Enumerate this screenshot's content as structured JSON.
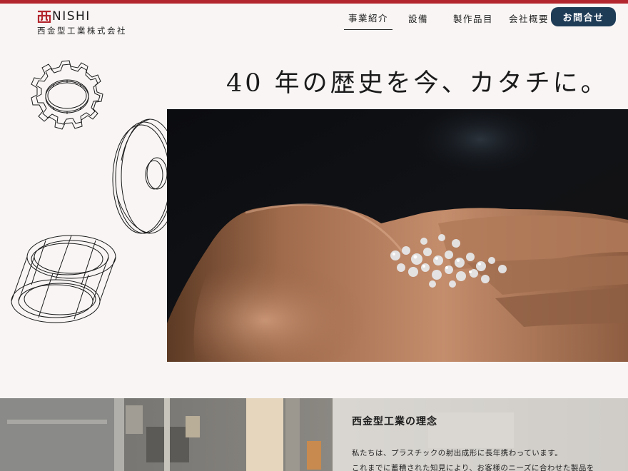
{
  "brand": {
    "mark": "西",
    "name": "NISHI",
    "company": "西金型工業株式会社",
    "accent_color": "#b3262d"
  },
  "nav": {
    "items": [
      {
        "label": "事業紹介",
        "active": true
      },
      {
        "label": "設備",
        "active": false
      },
      {
        "label": "製作品目",
        "active": false
      },
      {
        "label": "会社概要",
        "active": false
      }
    ],
    "contact_label": "お問合せ",
    "contact_color": "#1f3c57"
  },
  "hero": {
    "headline": "40 年の歴史を今、カタチに。",
    "photo": "hand-holding-plastic-pellets"
  },
  "about": {
    "title": "西金型工業の理念",
    "lines": [
      "私たちは、プラスチックの射出成形に長年携わっています。",
      "これまでに蓄積された知見により、お客様のニーズに合わせた製品を"
    ],
    "background": "factory-machinery"
  }
}
